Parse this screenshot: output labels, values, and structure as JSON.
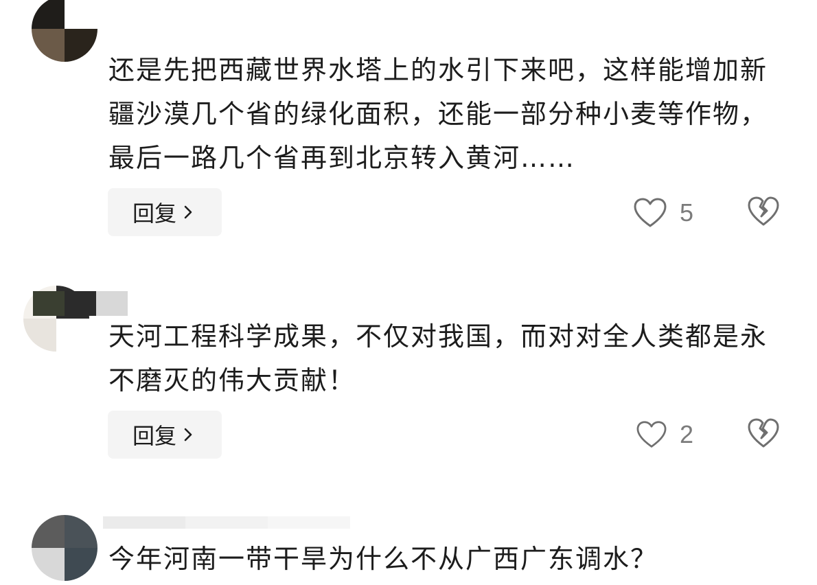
{
  "comments": [
    {
      "text": "还是先把西藏世界水塔上的水引下来吧，这样能增加新疆沙漠几个省的绿化面积，还能一部分种小麦等作物，最后一路几个省再到北京转入黄河……",
      "reply_label": "回复",
      "like_count": "5",
      "reply_icon": "chevron-right-icon",
      "like_icon": "heart-outline-icon",
      "dislike_icon": "broken-heart-icon"
    },
    {
      "text": "天河工程科学成果，不仅对我国，而对对全人类都是永不磨灭的伟大贡献！",
      "reply_label": "回复",
      "like_count": "2",
      "reply_icon": "chevron-right-icon",
      "like_icon": "heart-outline-icon",
      "dislike_icon": "broken-heart-icon"
    },
    {
      "text": "今年河南一带干旱为什么不从广西广东调水？"
    }
  ],
  "colors": {
    "text": "#1c1c1c",
    "muted": "#7b7b7b",
    "reply_bg": "#f4f4f4",
    "icon_stroke": "#6f6f6f"
  }
}
